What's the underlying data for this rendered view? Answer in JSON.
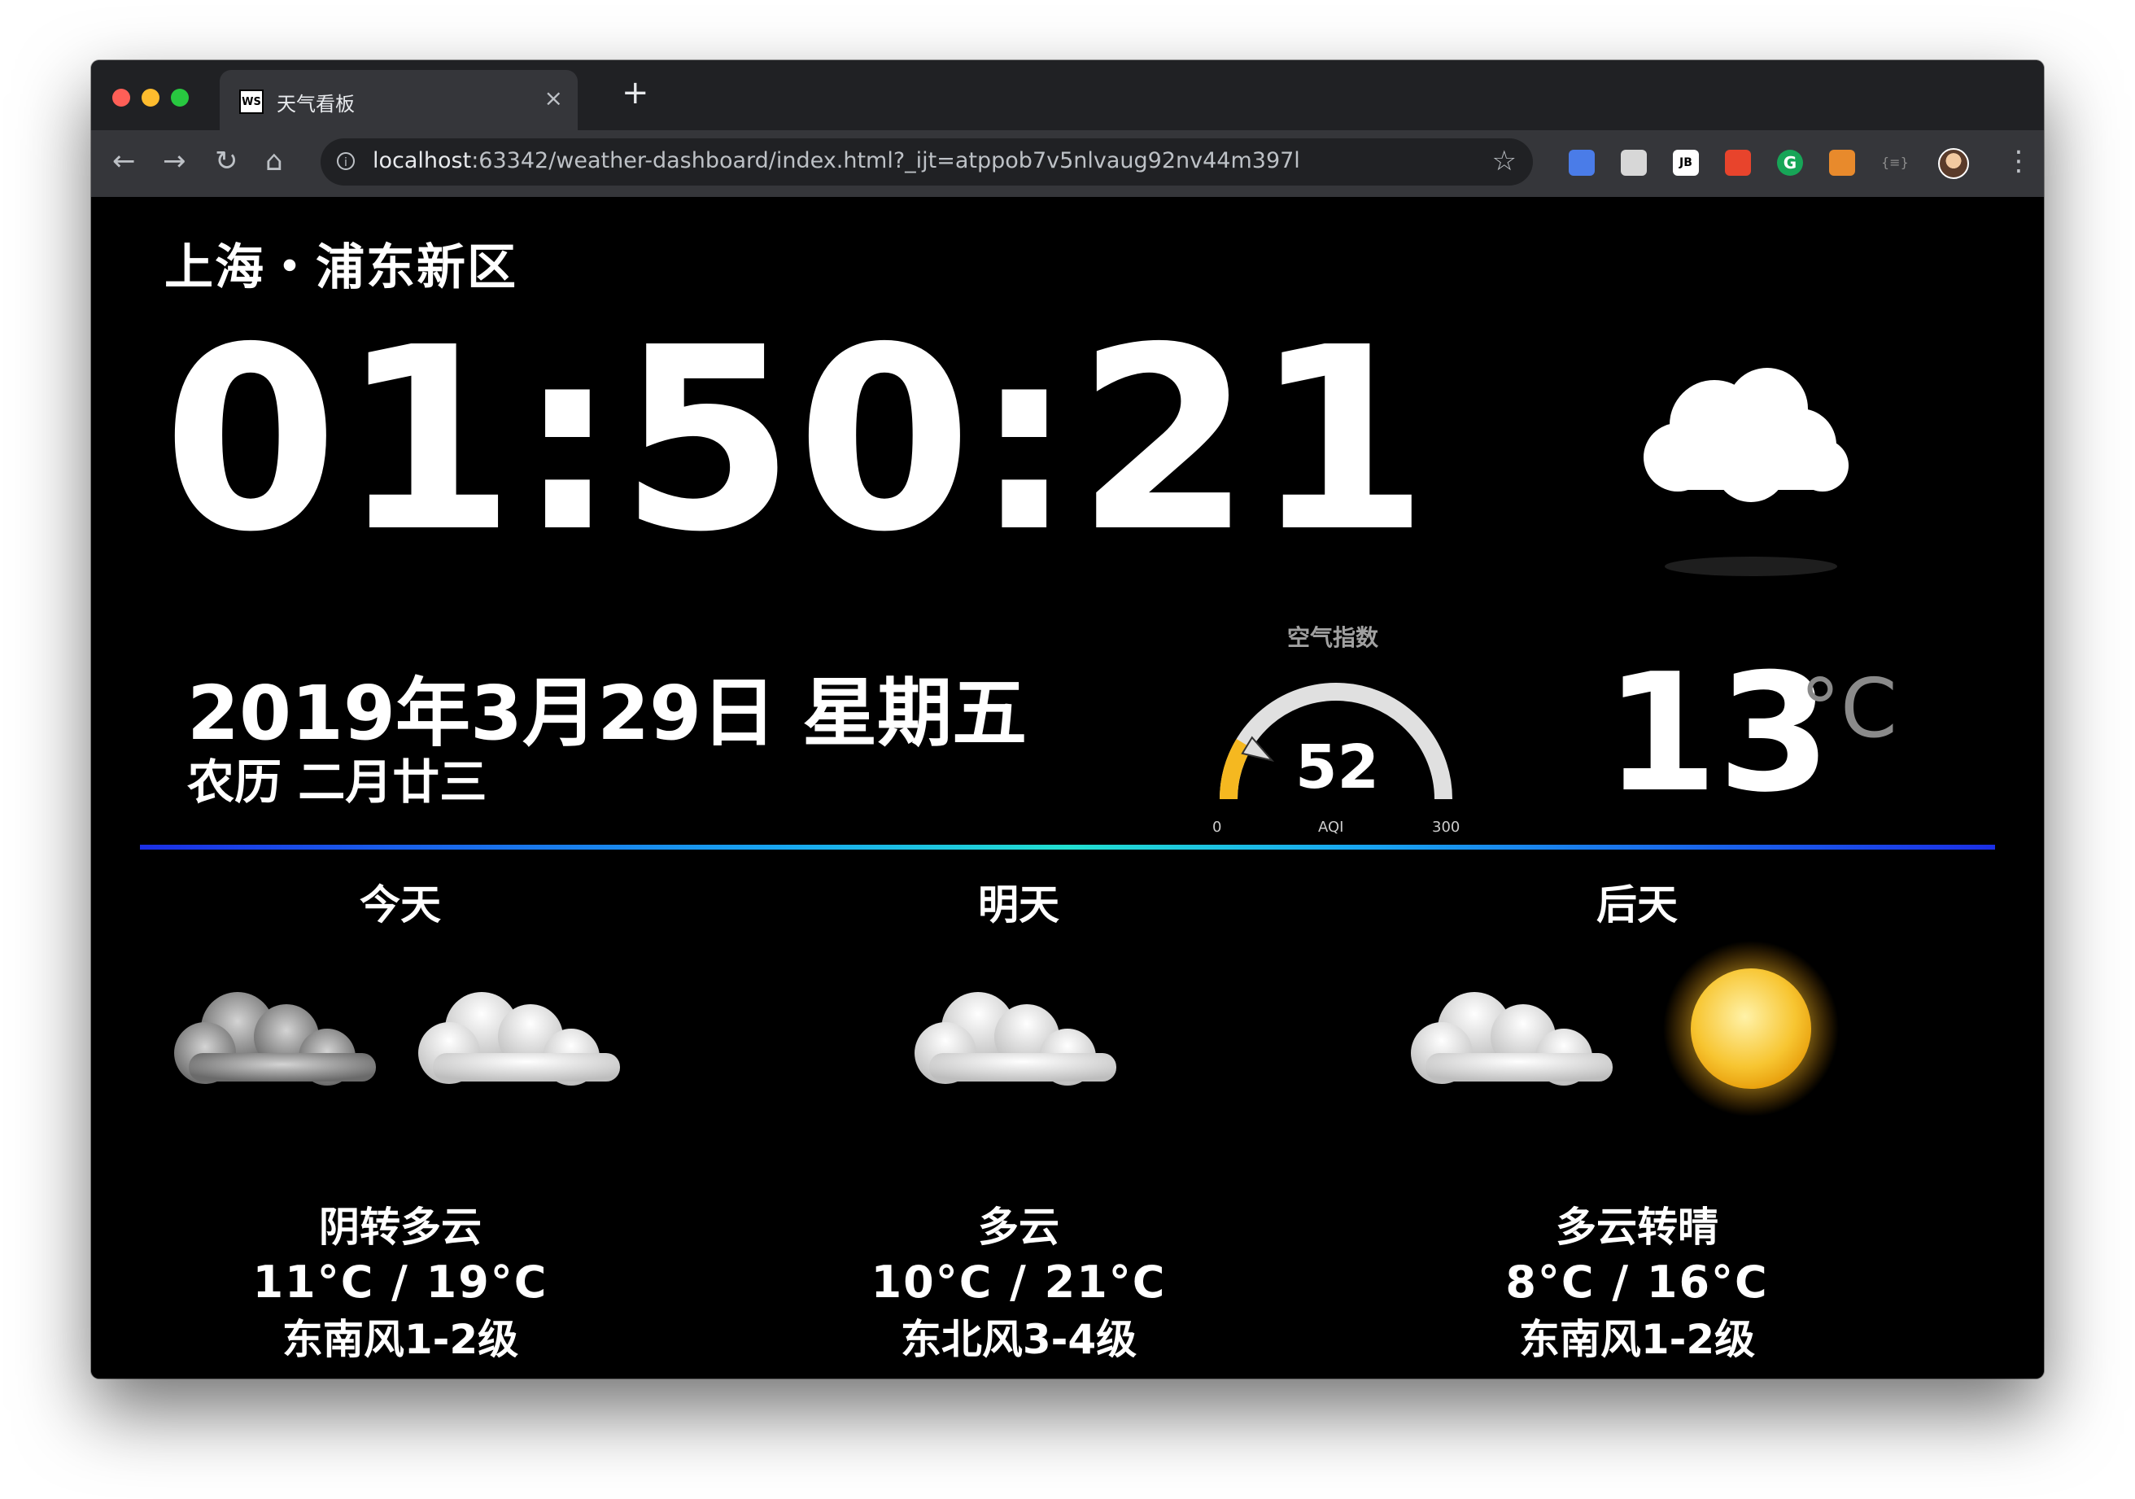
{
  "browser": {
    "tab_favicon": "WS",
    "tab_title": "天气看板",
    "tab_close": "×",
    "new_tab": "+",
    "url_host": "localhost",
    "url_rest": ":63342/weather-dashboard/index.html?_ijt=atppob7v5nlvaug92nv44m397l",
    "icons": [
      "back-icon",
      "forward-icon",
      "reload-icon",
      "home-icon",
      "info-icon",
      "star-icon",
      "camera-icon",
      "cube-icon",
      "jetbrains-icon",
      "office-icon",
      "grammarly-icon",
      "metamask-icon",
      "json-viewer-icon",
      "avatar",
      "menu-icon"
    ],
    "extension_colors": [
      "#4a7ce8",
      "#d7d7d7",
      "#ffffff",
      "#e8442c",
      "#17a557",
      "#e88a2c",
      "#8d8d8d"
    ]
  },
  "location": "上海・浦东新区",
  "time": "01:50:21",
  "date": "2019年3月29日 星期五",
  "lunar": "农历 二月廿三",
  "aqi": {
    "title": "空气指数",
    "value": "52",
    "min": "0",
    "max": "300",
    "unit": "AQI",
    "level_fraction": 0.173,
    "colors": {
      "low": "#f5b820",
      "track": "#e0e0e0"
    }
  },
  "current": {
    "icon": "cloud-icon",
    "temp": "13",
    "unit": "°C"
  },
  "forecast": [
    {
      "day": "今天",
      "condition": "阴转多云",
      "temp": "11°C / 19°C",
      "wind": "东南风1-2级",
      "icons": [
        "overcast-cloud-icon",
        "cloud-icon"
      ]
    },
    {
      "day": "明天",
      "condition": "多云",
      "temp": "10°C / 21°C",
      "wind": "东北风3-4级",
      "icons": [
        "cloud-icon"
      ]
    },
    {
      "day": "后天",
      "condition": "多云转晴",
      "temp": "8°C / 16°C",
      "wind": "东南风1-2级",
      "icons": [
        "cloud-icon",
        "sun-icon"
      ]
    }
  ]
}
